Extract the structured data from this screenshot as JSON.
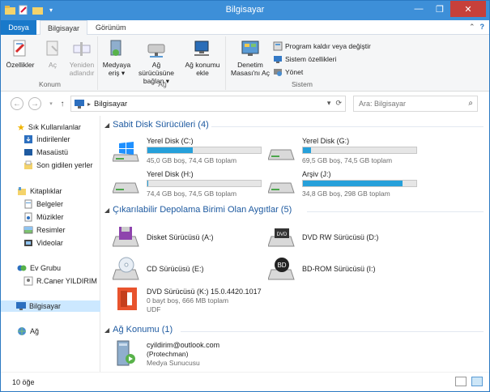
{
  "window": {
    "title": "Bilgisayar"
  },
  "tabs": {
    "file": "Dosya",
    "computer": "Bilgisayar",
    "view": "Görünüm"
  },
  "ribbon": {
    "groups": {
      "location": "Konum",
      "network": "Ağ",
      "system": "Sistem"
    },
    "properties": "Özellikler",
    "open": "Aç",
    "rename": [
      "Yeniden",
      "adlandır"
    ],
    "media_access": [
      "Medyaya",
      "eriş ▾"
    ],
    "map_drive": [
      "Ağ sürücüsüne",
      "bağlan ▾"
    ],
    "add_location": [
      "Ağ konumu",
      "ekle"
    ],
    "control_panel": [
      "Denetim",
      "Masası'nı Aç"
    ],
    "uninstall": "Program kaldır veya değiştir",
    "system_props": "Sistem özellikleri",
    "manage": "Yönet"
  },
  "address": {
    "path": "Bilgisayar",
    "search_placeholder": "Ara: Bilgisayar"
  },
  "nav": {
    "favorites": "Sık Kullanılanlar",
    "downloads": "İndirilenler",
    "desktop": "Masaüstü",
    "recent": "Son gidilen yerler",
    "libraries": "Kitaplıklar",
    "documents": "Belgeler",
    "music": "Müzikler",
    "pictures": "Resimler",
    "videos": "Videolar",
    "homegroup": "Ev Grubu",
    "user": "R.Caner YILDIRIM",
    "computer": "Bilgisayar",
    "network": "Ağ"
  },
  "sections": {
    "hdd": "Sabit Disk Sürücüleri (4)",
    "removable": "Çıkarılabilir Depolama Birimi Olan Aygıtlar (5)",
    "network": "Ağ Konumu (1)"
  },
  "drives": [
    {
      "name": "Yerel Disk (C:)",
      "info": "45,0 GB boş, 74,4 GB toplam",
      "used": 0.4
    },
    {
      "name": "Yerel Disk (G:)",
      "info": "69,5 GB boş, 74,5 GB toplam",
      "used": 0.07
    },
    {
      "name": "Yerel Disk (H:)",
      "info": "74,4 GB boş, 74,5 GB toplam",
      "used": 0.01
    },
    {
      "name": "Arşiv (J:)",
      "info": "34,8 GB boş, 298 GB toplam",
      "used": 0.88
    }
  ],
  "devices": {
    "floppy": "Disket Sürücüsü (A:)",
    "dvdrw": "DVD RW Sürücüsü (D:)",
    "cd": "CD Sürücüsü (E:)",
    "bd": "BD-ROM Sürücüsü (I:)",
    "dvd_name": "DVD Sürücüsü (K:) 15.0.4420.1017",
    "dvd_info": "0 bayt boş, 666 MB toplam",
    "dvd_fs": "UDF"
  },
  "netloc": {
    "line1": "cyildirim@outlook.com",
    "line2": "(Protechman)",
    "line3": "Medya Sunucusu"
  },
  "status": {
    "count": "10 öğe"
  },
  "colors": {
    "accent": "#3d8fd8",
    "bar": "#26a0da",
    "section": "#1e5aa0"
  }
}
